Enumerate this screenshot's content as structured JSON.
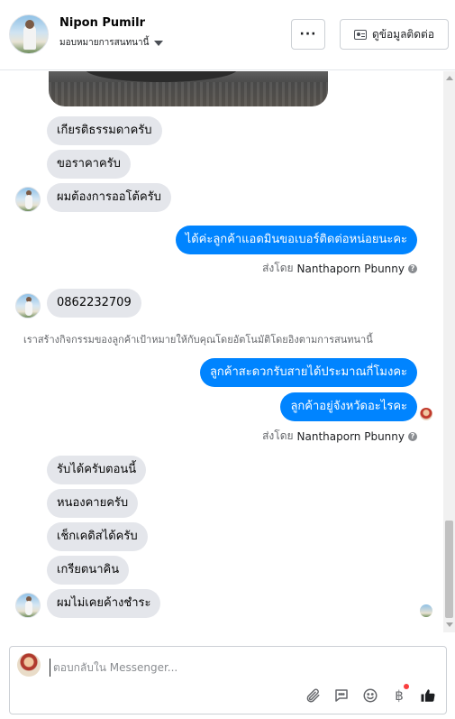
{
  "header": {
    "contact_name": "Nipon Pumilr",
    "assign_label": "มอบหมายการสนทนานี้",
    "more_label": "···",
    "view_contact_label": "ดูข้อมูลติดต่อ"
  },
  "thread": {
    "incoming_1": [
      "เกียรติธรรมดาครับ",
      "ขอราคาครับ",
      "ผมต้องการออโต้ครับ"
    ],
    "outgoing_1": "ได้ค่ะลูกค้าแอดมินขอเบอร์ติดต่อหน่อยนะคะ",
    "sent_by_1": {
      "prefix": "ส่งโดย",
      "name": "Nanthaporn Pbunny"
    },
    "phone_message": "0862232709",
    "system_note": "เราสร้างกิจกรรมของลูกค้าเป้าหมายให้กับคุณโดยอัตโนมัติโดยอิงตามการสนทนานี้",
    "outgoing_2": [
      "ลูกค้าสะดวกรับสายได้ประมาณกี่โมงคะ",
      "ลูกค้าอยู่จังหวัดอะไรคะ"
    ],
    "sent_by_2": {
      "prefix": "ส่งโดย",
      "name": "Nanthaporn Pbunny"
    },
    "incoming_2": [
      "รับได้ครับตอนนี้",
      "หนองคายครับ",
      "เช็กเคดิสได้ครับ",
      "เกรียตนาคิน",
      "ผมไม่เคยค้างชำระ"
    ]
  },
  "composer": {
    "placeholder": "ตอบกลับใน Messenger...",
    "currency_symbol": "฿"
  },
  "colors": {
    "outgoing_bubble": "#0084ff",
    "incoming_bubble": "#e4e6eb",
    "muted_text": "#65676b",
    "notification_dot": "#fa3e3e"
  }
}
